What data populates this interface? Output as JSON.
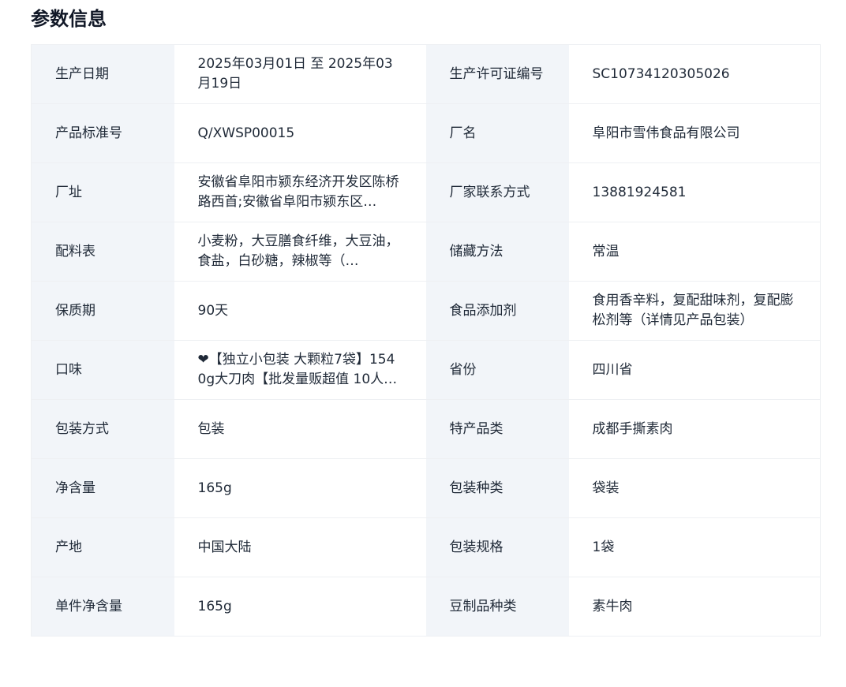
{
  "section_title": "参数信息",
  "rows": [
    [
      {
        "label": "生产日期",
        "value": "2025年03月01日 至 2025年03月19日"
      },
      {
        "label": "生产许可证编号",
        "value": "SC10734120305026"
      }
    ],
    [
      {
        "label": "产品标准号",
        "value": "Q/XWSP00015"
      },
      {
        "label": "厂名",
        "value": "阜阳市雪伟食品有限公司"
      }
    ],
    [
      {
        "label": "厂址",
        "value": "安徽省阜阳市颍东经济开发区陈桥路西首;安徽省阜阳市颍东区…"
      },
      {
        "label": "厂家联系方式",
        "value": "13881924581"
      }
    ],
    [
      {
        "label": "配料表",
        "value": "小麦粉，大豆膳食纤维，大豆油，食盐，白砂糖，辣椒等（…"
      },
      {
        "label": "储藏方法",
        "value": "常温"
      }
    ],
    [
      {
        "label": "保质期",
        "value": "90天"
      },
      {
        "label": "食品添加剂",
        "value": "食用香辛料，复配甜味剂，复配膨松剂等（详情见产品包装）"
      }
    ],
    [
      {
        "label": "口味",
        "value": "❤【独立小包装 大颗粒7袋】1540g大刀肉【批发量贩超值 10人…"
      },
      {
        "label": "省份",
        "value": "四川省"
      }
    ],
    [
      {
        "label": "包装方式",
        "value": "包装"
      },
      {
        "label": "特产品类",
        "value": "成都手撕素肉"
      }
    ],
    [
      {
        "label": "净含量",
        "value": "165g"
      },
      {
        "label": "包装种类",
        "value": "袋装"
      }
    ],
    [
      {
        "label": "产地",
        "value": "中国大陆"
      },
      {
        "label": "包装规格",
        "value": "1袋"
      }
    ],
    [
      {
        "label": "单件净含量",
        "value": "165g"
      },
      {
        "label": "豆制品种类",
        "value": "素牛肉"
      }
    ]
  ]
}
